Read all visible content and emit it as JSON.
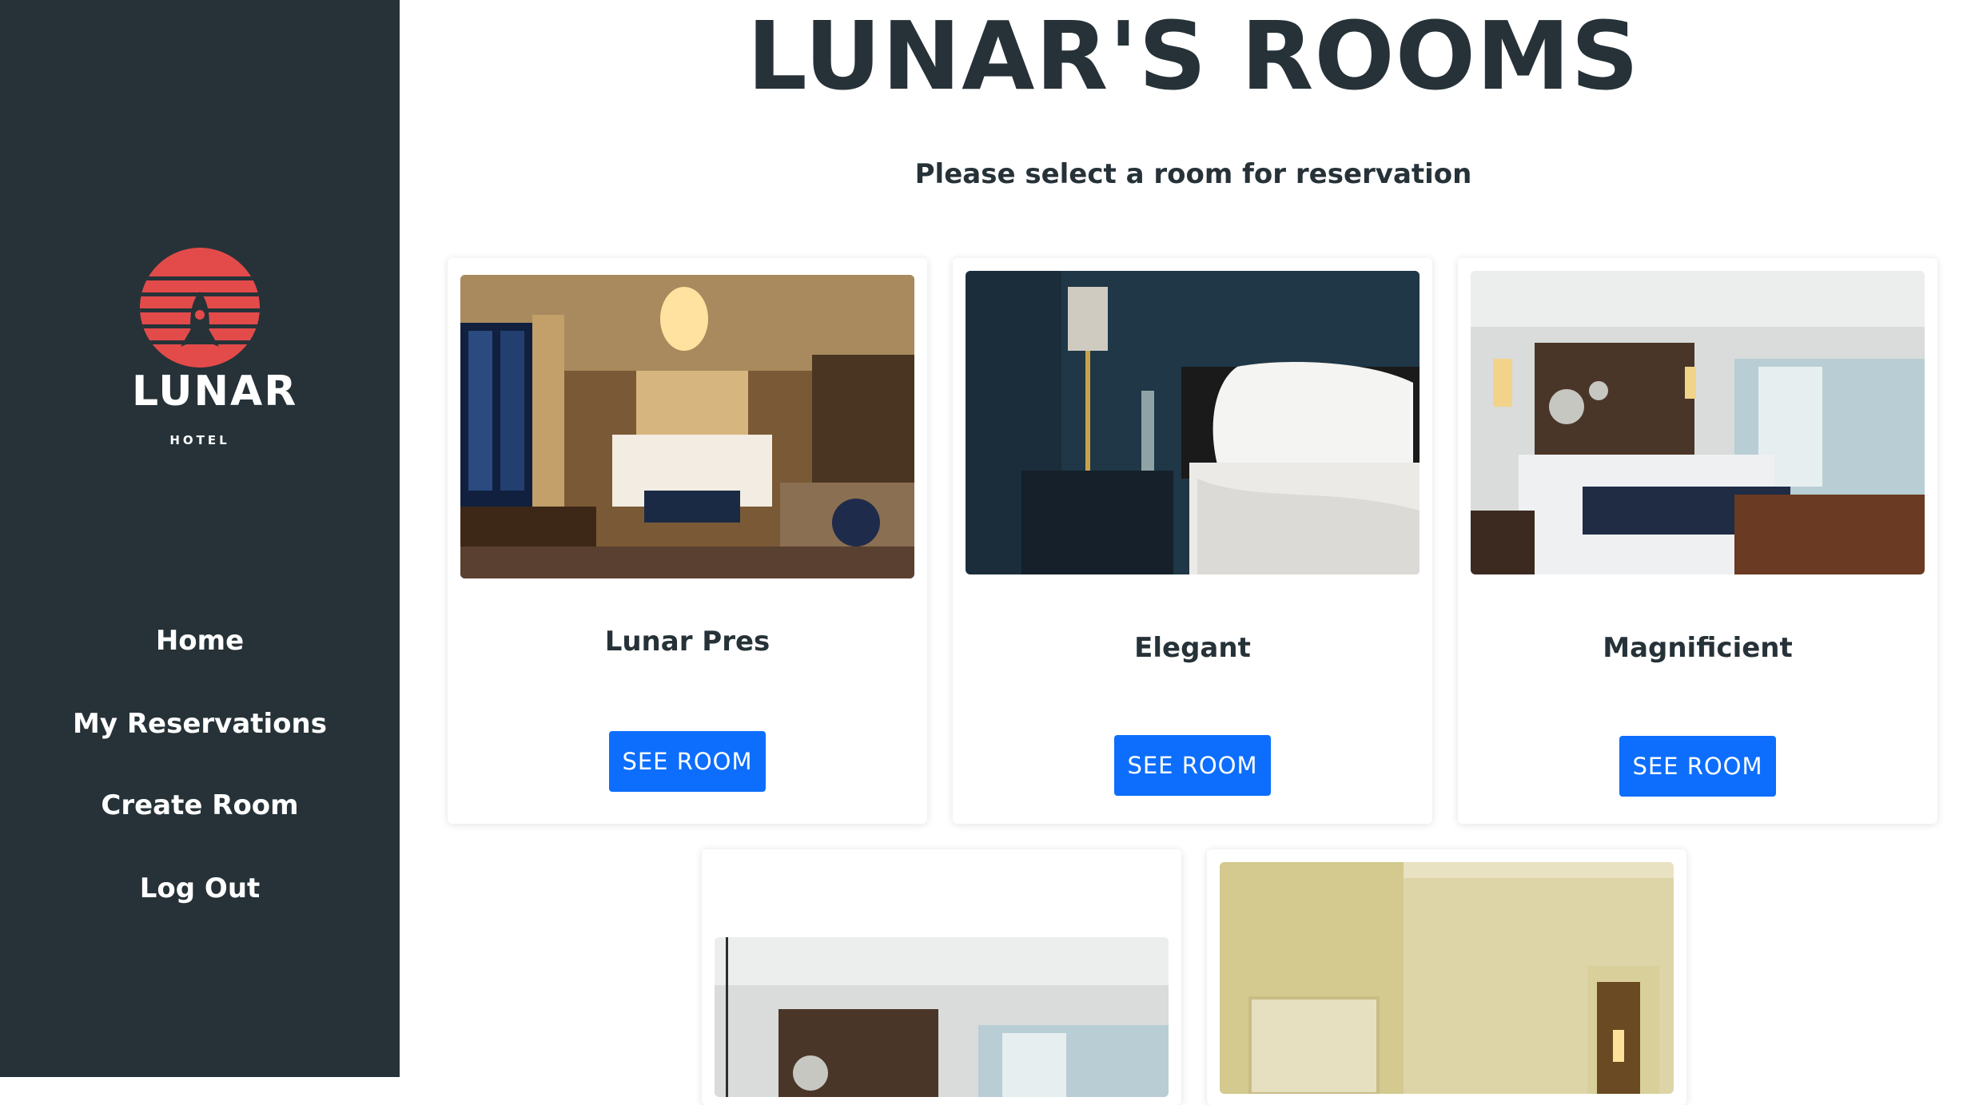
{
  "brand": {
    "name": "LUNAR",
    "sub": "HOTEL"
  },
  "sidebar": {
    "items": [
      {
        "label": "Home"
      },
      {
        "label": "My Reservations"
      },
      {
        "label": "Create Room"
      },
      {
        "label": "Log Out"
      }
    ]
  },
  "main": {
    "title": "LUNAR'S ROOMS",
    "subtitle": "Please select a room for reservation"
  },
  "rooms": [
    {
      "name": "Lunar Pres",
      "button": "SEE ROOM"
    },
    {
      "name": "Elegant",
      "button": "SEE ROOM"
    },
    {
      "name": "Magnificient",
      "button": "SEE ROOM"
    },
    {
      "name": "",
      "button": ""
    },
    {
      "name": "",
      "button": ""
    }
  ],
  "colors": {
    "sidebar": "#263238",
    "accent": "#0d6efd",
    "logo": "#e34b4b"
  }
}
